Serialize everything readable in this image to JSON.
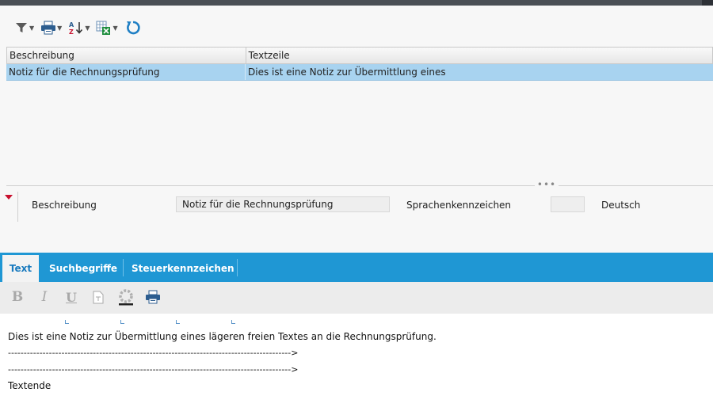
{
  "toolbar": {
    "icons": [
      "filter-icon",
      "print-icon",
      "sort-ascending-icon",
      "export-excel-icon",
      "refresh-icon"
    ]
  },
  "grid": {
    "columns": [
      "Beschreibung",
      "Textzeile"
    ],
    "rows": [
      {
        "beschreibung": "Notiz für die Rechnungsprüfung",
        "textzeile": "Dies ist eine Notiz zur Übermittlung eines"
      }
    ]
  },
  "form": {
    "beschreibung_label": "Beschreibung",
    "beschreibung_value": "Notiz für die Rechnungsprüfung",
    "sprache_label": "Sprachenkennzeichen",
    "sprache_value": "",
    "sprache_text": "Deutsch"
  },
  "tabs": [
    {
      "label": "Text",
      "active": true
    },
    {
      "label": "Suchbegriffe",
      "active": false
    },
    {
      "label": "Steuerkennzeichen",
      "active": false
    }
  ],
  "editor_toolbar": {
    "bold": "B",
    "italic": "I",
    "underline": "U",
    "icons": [
      "format-icon",
      "color-icon",
      "print-icon"
    ]
  },
  "editor": {
    "lines": [
      "Dies ist eine Notiz zur Übermittlung eines lägeren freien Textes an die Rechnungsprüfung.",
      "------------------------------------------------------------------------------------------>",
      "------------------------------------------------------------------------------------------>",
      "Textende"
    ]
  },
  "colors": {
    "accent": "#1f97d4",
    "selection": "#a8d3f0",
    "active_tab_text": "#1a7bbf"
  }
}
